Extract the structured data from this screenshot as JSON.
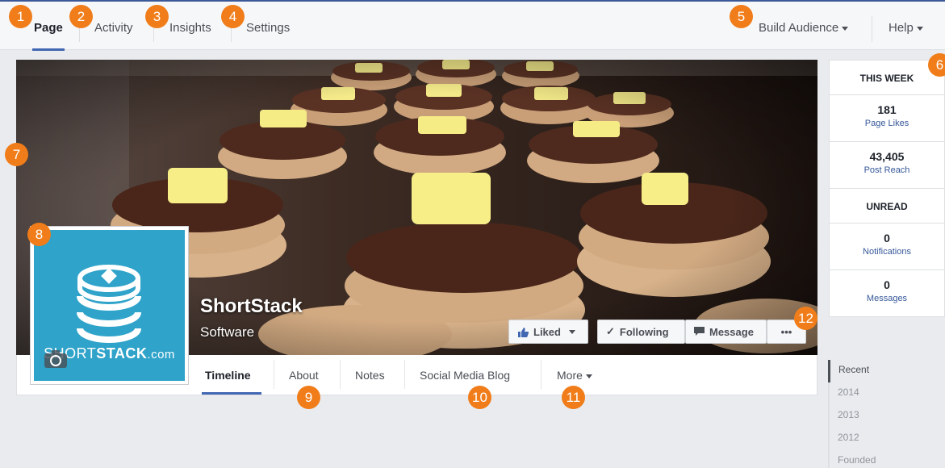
{
  "admin_nav": {
    "tabs": [
      {
        "label": "Page",
        "active": true
      },
      {
        "label": "Activity"
      },
      {
        "label": "Insights"
      },
      {
        "label": "Settings"
      }
    ],
    "build_audience": "Build Audience",
    "help": "Help"
  },
  "page": {
    "name": "ShortStack",
    "category": "Software",
    "logo_text_light": "SHORT",
    "logo_text_bold": "STACK",
    "logo_text_suffix": ".com"
  },
  "cover_buttons": {
    "liked": "Liked",
    "following": "Following",
    "message": "Message",
    "more": "•••"
  },
  "page_tabs": [
    {
      "label": "Timeline",
      "active": true
    },
    {
      "label": "About"
    },
    {
      "label": "Notes"
    },
    {
      "label": "Social Media Blog"
    },
    {
      "label": "More"
    }
  ],
  "sidebar": {
    "this_week": "THIS WEEK",
    "page_likes": {
      "value": "181",
      "label": "Page Likes"
    },
    "post_reach": {
      "value": "43,405",
      "label": "Post Reach"
    },
    "unread": "UNREAD",
    "notifications": {
      "value": "0",
      "label": "Notifications"
    },
    "messages": {
      "value": "0",
      "label": "Messages"
    }
  },
  "years": [
    "Recent",
    "2014",
    "2013",
    "2012",
    "Founded"
  ],
  "callouts": [
    "1",
    "2",
    "3",
    "4",
    "5",
    "6",
    "7",
    "8",
    "9",
    "10",
    "11",
    "12"
  ],
  "colors": {
    "accent": "#4267b2",
    "callout": "#f07d1a",
    "logo_bg": "#2fa3c9"
  }
}
